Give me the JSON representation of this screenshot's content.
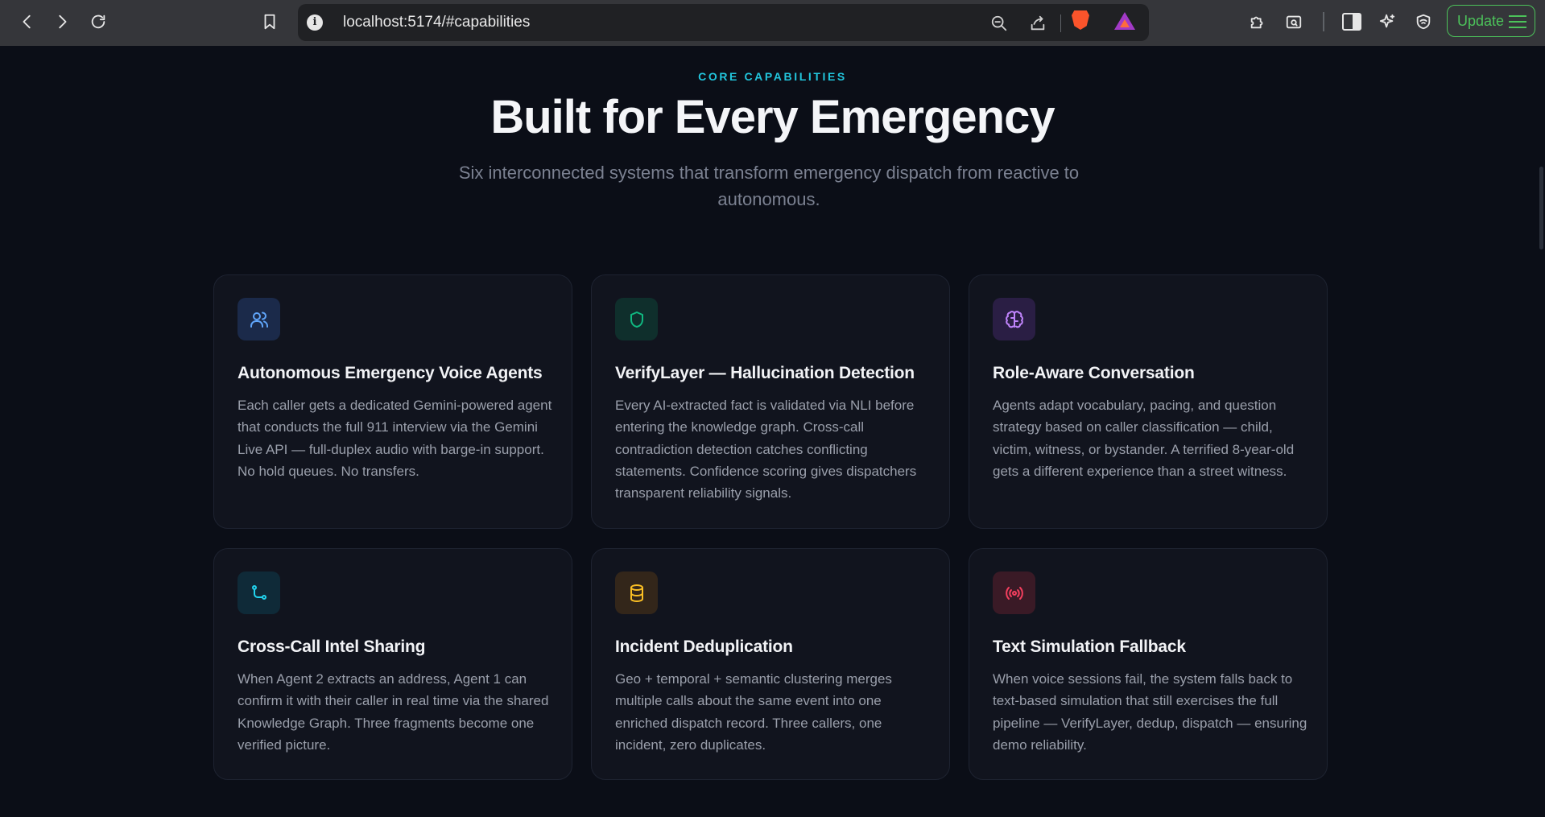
{
  "browser": {
    "url": "localhost:5174/#capabilities",
    "update_label": "Update"
  },
  "section": {
    "eyebrow": "CORE CAPABILITIES",
    "title": "Built for Every Emergency",
    "subtitle": "Six interconnected systems that transform emergency dispatch from reactive to autonomous."
  },
  "cards": [
    {
      "icon": "users-icon",
      "icon_color": "#60a5fa",
      "icon_bg": "#1b2a4a",
      "title": "Autonomous Emergency Voice Agents",
      "description": "Each caller gets a dedicated Gemini-powered agent that conducts the full 911 interview via the Gemini Live API — full-duplex audio with barge-in support. No hold queues. No transfers."
    },
    {
      "icon": "shield-icon",
      "icon_color": "#10b981",
      "icon_bg": "#0f2f2c",
      "title": "VerifyLayer — Hallucination Detection",
      "description": "Every AI-extracted fact is validated via NLI before entering the knowledge graph. Cross-call contradiction detection catches conflicting statements. Confidence scoring gives dispatchers transparent reliability signals."
    },
    {
      "icon": "brain-icon",
      "icon_color": "#c084fc",
      "icon_bg": "#2a1e44",
      "title": "Role-Aware Conversation",
      "description": "Agents adapt vocabulary, pacing, and question strategy based on caller classification — child, victim, witness, or bystander. A terrified 8-year-old gets a different experience than a street witness."
    },
    {
      "icon": "git-branch-icon",
      "icon_color": "#22d3ee",
      "icon_bg": "#0f2a38",
      "title": "Cross-Call Intel Sharing",
      "description": "When Agent 2 extracts an address, Agent 1 can confirm it with their caller in real time via the shared Knowledge Graph. Three fragments become one verified picture."
    },
    {
      "icon": "database-icon",
      "icon_color": "#fbbf24",
      "icon_bg": "#33261a",
      "title": "Incident Deduplication",
      "description": "Geo + temporal + semantic clustering merges multiple calls about the same event into one enriched dispatch record. Three callers, one incident, zero duplicates."
    },
    {
      "icon": "radio-icon",
      "icon_color": "#f43f5e",
      "icon_bg": "#3a1a26",
      "title": "Text Simulation Fallback",
      "description": "When voice sessions fail, the system falls back to text-based simulation that still exercises the full pipeline — VerifyLayer, dedup, dispatch — ensuring demo reliability."
    }
  ]
}
